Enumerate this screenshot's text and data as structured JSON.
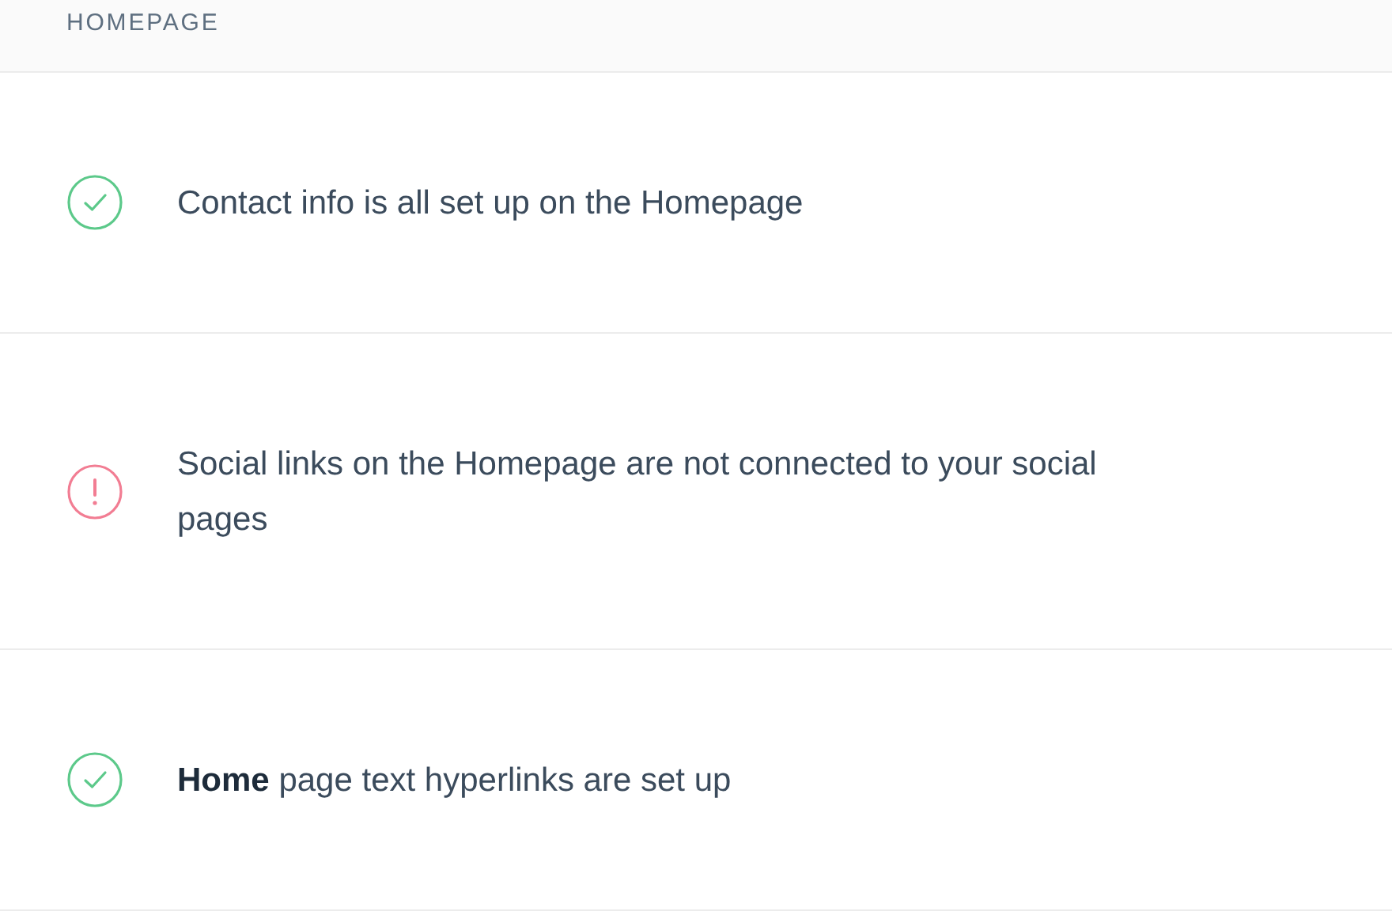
{
  "section": {
    "title": "HOMEPAGE"
  },
  "items": [
    {
      "kind": "ok",
      "text": "Contact info is all set up on the Homepage"
    },
    {
      "kind": "warning",
      "text": "Social links on the Homepage are not connected to your social pages"
    },
    {
      "kind": "ok",
      "text": "**Home** page text hyperlinks are set up"
    }
  ]
}
